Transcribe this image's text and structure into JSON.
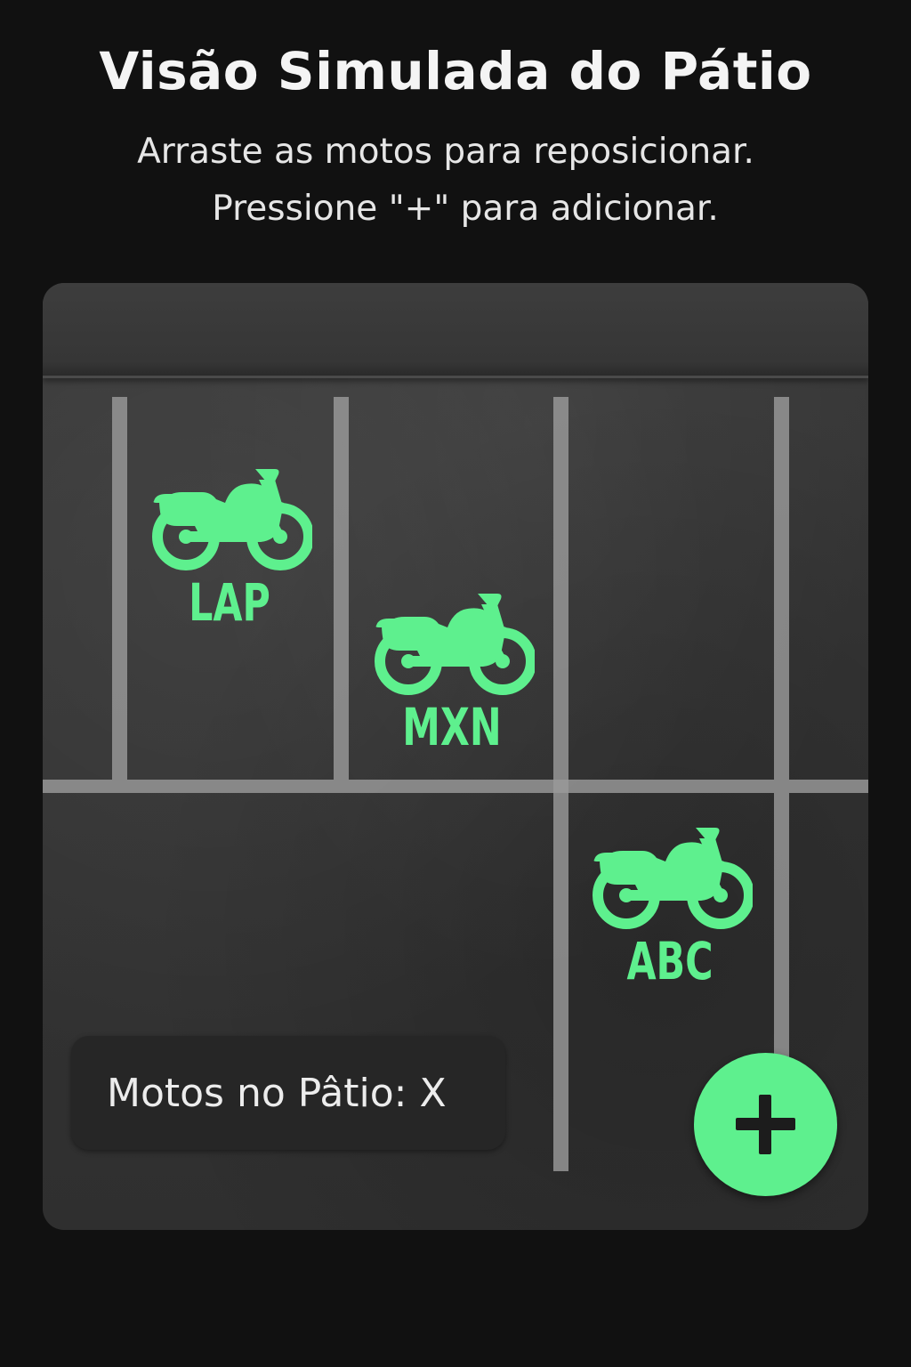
{
  "header": {
    "title": "Visão Simulada do Pátio",
    "subtitle_line1": "Arraste as motos para reposicionar.",
    "subtitle_line2": "Pressione \"+\" para adicionar."
  },
  "yard": {
    "motorcycles": [
      {
        "plate": "LAP",
        "icon": "motorcycle-icon"
      },
      {
        "plate": "MXN",
        "icon": "motorcycle-icon"
      },
      {
        "plate": "ABC",
        "icon": "motorcycle-icon"
      }
    ],
    "counter_text": "Motos no Pâtio: X"
  },
  "fab": {
    "icon": "plus-icon"
  },
  "colors": {
    "background": "#111111",
    "accent": "#5ef08e",
    "yard": "#363636",
    "lines": "#9a9a9a",
    "counter_bg": "#262626"
  }
}
